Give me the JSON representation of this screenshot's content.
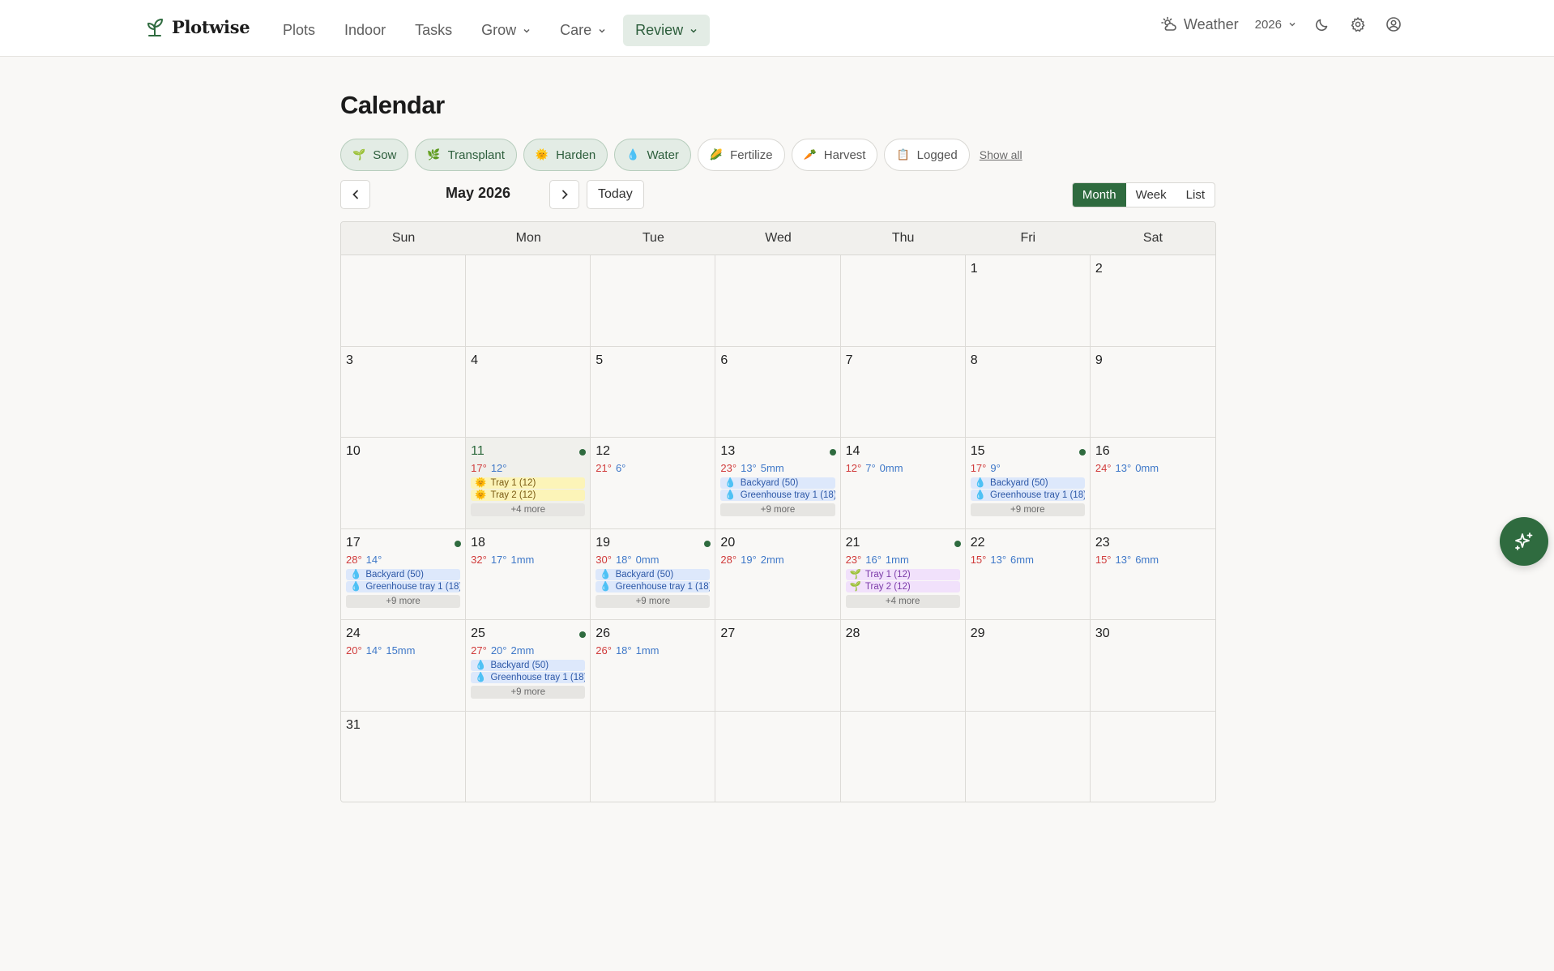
{
  "brand": {
    "name": "Plotwise"
  },
  "nav": {
    "links": [
      {
        "label": "Plots",
        "dropdown": false,
        "active": false
      },
      {
        "label": "Indoor",
        "dropdown": false,
        "active": false
      },
      {
        "label": "Tasks",
        "dropdown": false,
        "active": false
      },
      {
        "label": "Grow",
        "dropdown": true,
        "active": false
      },
      {
        "label": "Care",
        "dropdown": true,
        "active": false
      },
      {
        "label": "Review",
        "dropdown": true,
        "active": true
      }
    ],
    "weather_label": "Weather",
    "year": "2026"
  },
  "page": {
    "title": "Calendar"
  },
  "filters": {
    "chips": [
      {
        "label": "Sow",
        "icon": "🌱",
        "on": true
      },
      {
        "label": "Transplant",
        "icon": "🌿",
        "on": true
      },
      {
        "label": "Harden",
        "icon": "🌞",
        "on": true
      },
      {
        "label": "Water",
        "icon": "💧",
        "on": true
      },
      {
        "label": "Fertilize",
        "icon": "🌽",
        "on": false
      },
      {
        "label": "Harvest",
        "icon": "🥕",
        "on": false
      },
      {
        "label": "Logged",
        "icon": "📋",
        "on": false
      }
    ],
    "show_all": "Show all"
  },
  "toolbar": {
    "month_label": "May 2026",
    "today_label": "Today",
    "views": [
      "Month",
      "Week",
      "List"
    ],
    "active_view": "Month"
  },
  "calendar": {
    "weekdays": [
      "Sun",
      "Mon",
      "Tue",
      "Wed",
      "Thu",
      "Fri",
      "Sat"
    ],
    "cells": [
      {},
      {},
      {},
      {},
      {},
      {
        "day": "1"
      },
      {
        "day": "2"
      },
      {
        "day": "3"
      },
      {
        "day": "4"
      },
      {
        "day": "5"
      },
      {
        "day": "6"
      },
      {
        "day": "7"
      },
      {
        "day": "8"
      },
      {
        "day": "9"
      },
      {
        "day": "10"
      },
      {
        "day": "11",
        "today": true,
        "dot": true,
        "hi": "17°",
        "lo": "12°",
        "rain": "",
        "events": [
          {
            "type": "harden",
            "icon": "🌞",
            "text": "Tray 1 (12)"
          },
          {
            "type": "harden",
            "icon": "🌞",
            "text": "Tray 2 (12)"
          }
        ],
        "more": "+4 more"
      },
      {
        "day": "12",
        "hi": "21°",
        "lo": "6°",
        "rain": ""
      },
      {
        "day": "13",
        "dot": true,
        "hi": "23°",
        "lo": "13°",
        "rain": "5mm",
        "events": [
          {
            "type": "water",
            "icon": "💧",
            "text": "Backyard (50)"
          },
          {
            "type": "water",
            "icon": "💧",
            "text": "Greenhouse tray 1 (18)"
          }
        ],
        "more": "+9 more"
      },
      {
        "day": "14",
        "hi": "12°",
        "lo": "7°",
        "rain": "0mm"
      },
      {
        "day": "15",
        "dot": true,
        "hi": "17°",
        "lo": "9°",
        "rain": "",
        "events": [
          {
            "type": "water",
            "icon": "💧",
            "text": "Backyard (50)"
          },
          {
            "type": "water",
            "icon": "💧",
            "text": "Greenhouse tray 1 (18)"
          }
        ],
        "more": "+9 more"
      },
      {
        "day": "16",
        "hi": "24°",
        "lo": "13°",
        "rain": "0mm"
      },
      {
        "day": "17",
        "dot": true,
        "hi": "28°",
        "lo": "14°",
        "rain": "",
        "events": [
          {
            "type": "water",
            "icon": "💧",
            "text": "Backyard (50)"
          },
          {
            "type": "water",
            "icon": "💧",
            "text": "Greenhouse tray 1 (18)"
          }
        ],
        "more": "+9 more"
      },
      {
        "day": "18",
        "hi": "32°",
        "lo": "17°",
        "rain": "1mm"
      },
      {
        "day": "19",
        "dot": true,
        "hi": "30°",
        "lo": "18°",
        "rain": "0mm",
        "events": [
          {
            "type": "water",
            "icon": "💧",
            "text": "Backyard (50)"
          },
          {
            "type": "water",
            "icon": "💧",
            "text": "Greenhouse tray 1 (18)"
          }
        ],
        "more": "+9 more"
      },
      {
        "day": "20",
        "hi": "28°",
        "lo": "19°",
        "rain": "2mm"
      },
      {
        "day": "21",
        "dot": true,
        "hi": "23°",
        "lo": "16°",
        "rain": "1mm",
        "events": [
          {
            "type": "sow",
            "icon": "🌱",
            "text": "Tray 1 (12)"
          },
          {
            "type": "sow",
            "icon": "🌱",
            "text": "Tray 2 (12)"
          }
        ],
        "more": "+4 more"
      },
      {
        "day": "22",
        "hi": "15°",
        "lo": "13°",
        "rain": "6mm"
      },
      {
        "day": "23",
        "hi": "15°",
        "lo": "13°",
        "rain": "6mm"
      },
      {
        "day": "24",
        "hi": "20°",
        "lo": "14°",
        "rain": "15mm"
      },
      {
        "day": "25",
        "dot": true,
        "hi": "27°",
        "lo": "20°",
        "rain": "2mm",
        "events": [
          {
            "type": "water",
            "icon": "💧",
            "text": "Backyard (50)"
          },
          {
            "type": "water",
            "icon": "💧",
            "text": "Greenhouse tray 1 (18)"
          }
        ],
        "more": "+9 more"
      },
      {
        "day": "26",
        "hi": "26°",
        "lo": "18°",
        "rain": "1mm"
      },
      {
        "day": "27"
      },
      {
        "day": "28"
      },
      {
        "day": "29"
      },
      {
        "day": "30"
      },
      {
        "day": "31"
      },
      {},
      {},
      {},
      {},
      {},
      {}
    ]
  },
  "colors": {
    "accent": "#2f6b3f",
    "high_temp": "#d03b3b",
    "low_temp": "#3f78c8",
    "harden_event": "#fcf4b8",
    "water_event": "#dde8fb",
    "sow_event": "#f1e1fb"
  },
  "icons": {
    "brand": "sprout-icon",
    "weather": "sun-cloud-icon",
    "theme": "moon-icon",
    "settings": "gear-icon",
    "account": "user-circle-icon",
    "fab": "sparkles-icon"
  }
}
